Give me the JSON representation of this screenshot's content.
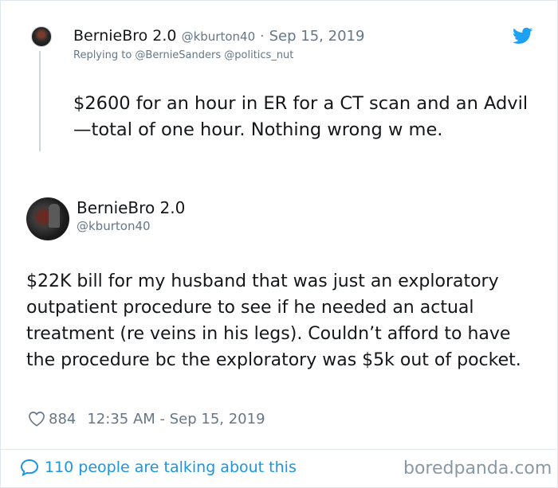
{
  "parent_tweet": {
    "display_name": "BernieBro 2.0",
    "handle": "@kburton40",
    "separator": "·",
    "date": "Sep 15, 2019",
    "replying_to": "Replying to @BernieSanders @politics_nut",
    "text": "$2600 for an hour in ER for a CT scan and an Advil—total of one hour. Nothing wrong w me."
  },
  "main_tweet": {
    "display_name": "BernieBro 2.0",
    "handle": "@kburton40",
    "text": "$22K bill for my husband that was just an exploratory outpatient procedure to see if he needed an actual treatment (re veins in his legs). Couldn’t afford to have the procedure bc the exploratory was $5k out of pocket.",
    "like_count": "884",
    "timestamp": "12:35 AM - Sep 15, 2019"
  },
  "footer": {
    "talking_label": "110 people are talking about this",
    "watermark": "boredpanda.com"
  },
  "colors": {
    "twitter_blue": "#1da1f2",
    "link_blue": "#1b95e0",
    "secondary_text": "#657786",
    "border": "#e1e8ed"
  },
  "icons": [
    "twitter-bird-icon",
    "heart-icon",
    "speech-bubble-icon"
  ]
}
